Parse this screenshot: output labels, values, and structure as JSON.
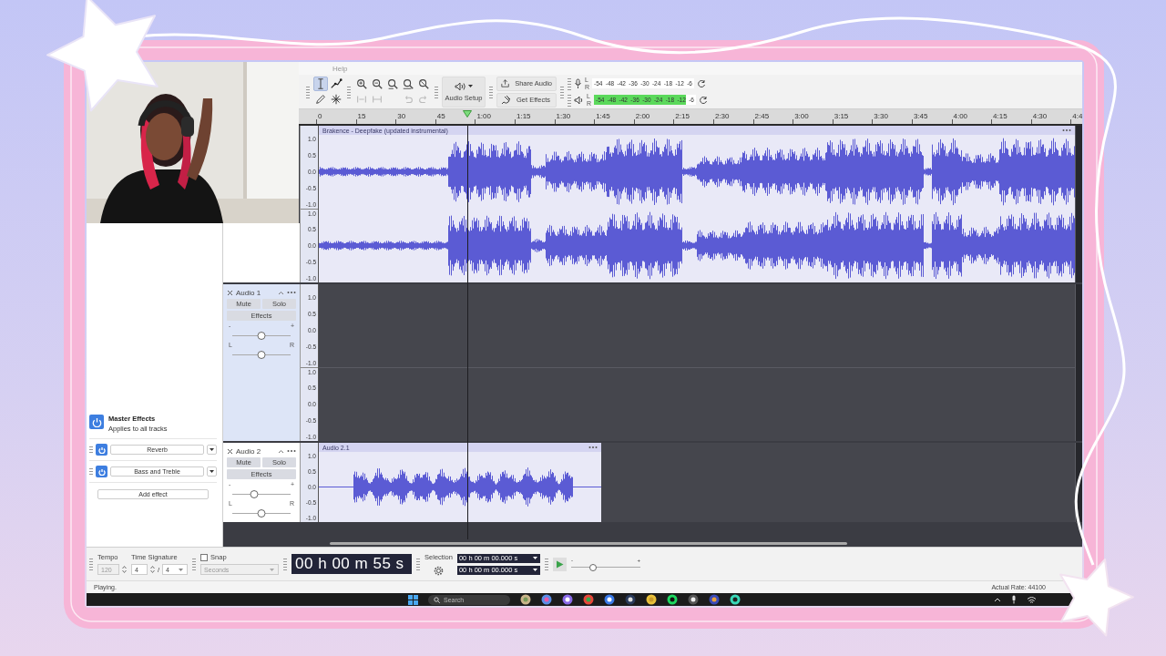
{
  "menu": [
    {
      "label": "Help"
    }
  ],
  "toolbar": {
    "tools": [
      {
        "kind": "select",
        "selected": true
      },
      {
        "kind": "envelope",
        "selected": false
      },
      {
        "kind": "draw",
        "selected": false
      },
      {
        "kind": "multi",
        "selected": false
      }
    ],
    "edit_buttons": [
      {
        "kind": "zoom-in",
        "disabled": false
      },
      {
        "kind": "zoom-out",
        "disabled": false
      },
      {
        "kind": "fit-selection",
        "disabled": false
      },
      {
        "kind": "fit-project",
        "disabled": false
      },
      {
        "kind": "zoom-toggle",
        "disabled": false
      },
      {
        "kind": "trim",
        "disabled": true
      },
      {
        "kind": "silence",
        "disabled": true
      },
      {
        "kind": "undo",
        "disabled": true
      },
      {
        "kind": "redo",
        "disabled": true
      }
    ],
    "audio_setup": {
      "label": "Audio Setup"
    },
    "share_audio": {
      "label": "Share Audio"
    },
    "get_effects": {
      "label": "Get Effects"
    },
    "meters": [
      {
        "kind": "record",
        "channels": [
          "L",
          "R"
        ],
        "ticks": [
          "-54",
          "-48",
          "-42",
          "-36",
          "-30",
          "-24",
          "-18",
          "-12",
          "-6"
        ],
        "level": 0
      },
      {
        "kind": "playback",
        "channels": [
          "L",
          "R"
        ],
        "ticks": [
          "-54",
          "-48",
          "-42",
          "-36",
          "-30",
          "-24",
          "-18",
          "-12",
          "-6"
        ],
        "level": 0.9
      }
    ]
  },
  "timeline": {
    "labels": [
      "0",
      "15",
      "30",
      "45",
      "1:00",
      "1:15",
      "1:30",
      "1:45",
      "2:00",
      "2:15",
      "2:30",
      "2:45",
      "3:00",
      "3:15",
      "3:30",
      "3:45",
      "4:00",
      "4:15",
      "4:30",
      "4:4"
    ],
    "playhead": {
      "level": 0.196
    }
  },
  "tracks": [
    {
      "selected": false,
      "clip": {
        "title": "Brakence - Deepfake (updated instrumental)"
      },
      "rulers": [
        [
          "1.0",
          "0.5",
          "0.0",
          "-0.5",
          "-1.0"
        ],
        [
          "1.0",
          "0.5",
          "0.0",
          "-0.5",
          "-1.0"
        ]
      ]
    },
    {
      "name": "Audio 1",
      "selected": true,
      "mute": "Mute",
      "solo": "Solo",
      "effects": "Effects",
      "gain": {
        "minus": "-",
        "plus": "+",
        "level": 0.5
      },
      "pan": {
        "left": "L",
        "right": "R",
        "level": 0.5
      },
      "rulers": [
        [
          "1.0",
          "0.5",
          "0.0",
          "-0.5",
          "-1.0"
        ],
        [
          "1.0",
          "0.5",
          "0.0",
          "-0.5",
          "-1.0"
        ]
      ]
    },
    {
      "name": "Audio 2",
      "selected": false,
      "mute": "Mute",
      "solo": "Solo",
      "effects": "Effects",
      "gain": {
        "minus": "-",
        "plus": "+",
        "level": 0.38
      },
      "pan": {
        "left": "L",
        "right": "R",
        "level": 0.5
      },
      "clip": {
        "title": "Audio 2.1"
      },
      "rulers": [
        [
          "1.0",
          "0.5",
          "0.0",
          "-0.5",
          "-1.0"
        ]
      ]
    }
  ],
  "master_effects": {
    "title": "Master Effects",
    "subtitle": "Applies to all tracks",
    "on": true,
    "effects": [
      {
        "name": "Reverb",
        "on": true
      },
      {
        "name": "Bass and Treble",
        "on": true
      }
    ],
    "add_label": "Add effect"
  },
  "bottom_bar": {
    "tempo_label": "Tempo",
    "tempo": "120",
    "time_signature_label": "Time Signature",
    "beats": "4",
    "slash": "/",
    "unit": "4",
    "snap": {
      "label": "Snap",
      "checked": false
    },
    "snap_unit": "Seconds",
    "time": "00 h 00 m 55 s",
    "selection_label": "Selection",
    "selection": [
      "00 h 00 m 00.000 s",
      "00 h 00 m 00.000 s"
    ],
    "speed": {
      "minus": "-",
      "plus": "+",
      "level": 0.32
    }
  },
  "status_bar": {
    "state": "Playing.",
    "rate": "Actual Rate: 44100"
  },
  "taskbar": {
    "search_placeholder": "Search"
  }
}
